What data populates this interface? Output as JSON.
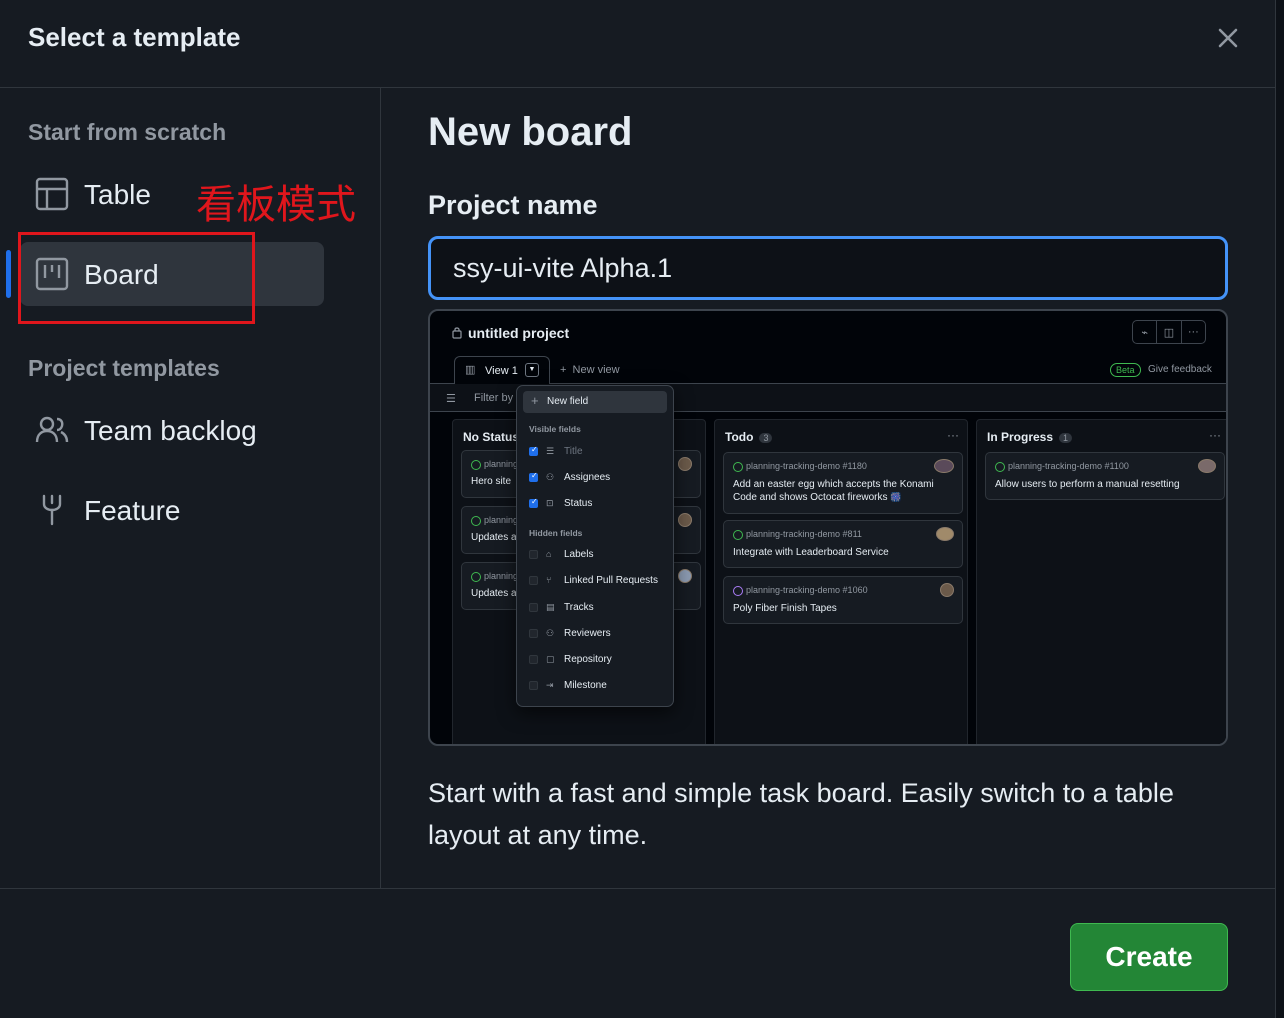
{
  "dialog": {
    "title": "Select a template",
    "close_icon": "close-icon"
  },
  "sidebar": {
    "scratch_heading": "Start from scratch",
    "scratch_items": [
      {
        "label": "Table",
        "icon": "table-icon",
        "selected": false
      },
      {
        "label": "Board",
        "icon": "board-icon",
        "selected": true
      }
    ],
    "templates_heading": "Project templates",
    "template_items": [
      {
        "label": "Team backlog",
        "icon": "people-icon"
      },
      {
        "label": "Feature",
        "icon": "fork-icon"
      }
    ]
  },
  "annotation": {
    "text": "看板模式",
    "color": "#e0161c"
  },
  "main": {
    "heading": "New board",
    "project_name_label": "Project name",
    "project_name_value": "ssy-ui-vite Alpha.1",
    "description": "Start with a fast and simple task board. Easily switch to a table layout at any time."
  },
  "preview": {
    "project_title": "untitled project",
    "view_tab": "View 1",
    "new_view": "New view",
    "beta_badge": "Beta",
    "feedback": "Give feedback",
    "filter_placeholder": "Filter by",
    "columns": [
      {
        "name": "No Status",
        "peek_cards": [
          {
            "repo": "planning",
            "text": "Hero site"
          },
          {
            "repo": "planning",
            "text": "Updates a"
          },
          {
            "repo": "planning",
            "text": "Updates a"
          }
        ]
      },
      {
        "name": "Todo",
        "count": "3",
        "cards": [
          {
            "repo": "planning-tracking-demo #1180",
            "text": "Add an easter egg which accepts the Konami Code and shows Octocat fireworks",
            "emoji": "🎆"
          },
          {
            "repo": "planning-tracking-demo #811",
            "text": "Integrate with Leaderboard Service"
          },
          {
            "repo": "planning-tracking-demo #1060",
            "text": "Poly Fiber Finish Tapes"
          }
        ]
      },
      {
        "name": "In Progress",
        "count": "1",
        "cards": [
          {
            "repo": "planning-tracking-demo #1100",
            "text": "Allow users to perform a manual resetting"
          }
        ]
      }
    ],
    "field_menu": {
      "new_field": "New field",
      "visible_heading": "Visible fields",
      "visible": [
        "Title",
        "Assignees",
        "Status"
      ],
      "hidden_heading": "Hidden fields",
      "hidden": [
        "Labels",
        "Linked Pull Requests",
        "Tracks",
        "Reviewers",
        "Repository",
        "Milestone"
      ]
    }
  },
  "footer": {
    "create_label": "Create",
    "create_color": "#238636"
  },
  "colors": {
    "accent": "#1f6feb",
    "input_border": "#4493f8",
    "panel_bg": "#161b22"
  }
}
